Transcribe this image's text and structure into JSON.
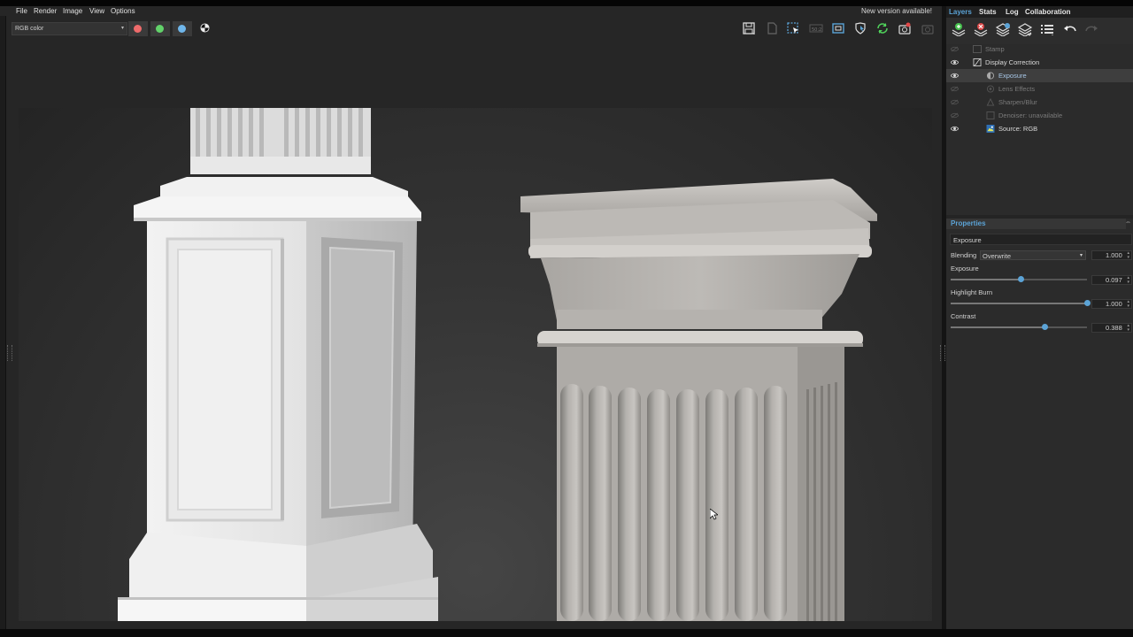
{
  "menu": {
    "items": [
      "File",
      "Render",
      "Image",
      "View",
      "Options"
    ],
    "update_notice": "New version available!"
  },
  "toolbar": {
    "display_mode": "RGB color",
    "channel_colors": {
      "red": "#ee6b6b",
      "green": "#62d26a",
      "blue": "#6fb6ea"
    },
    "icons": [
      "save-icon",
      "save-as-icon",
      "region-select-icon",
      "denoise-icon",
      "frame-icon",
      "shield-icon",
      "refresh-icon",
      "camera-reset-icon",
      "camera-icon"
    ]
  },
  "panel": {
    "tabs": [
      "Layers",
      "Stats",
      "Log",
      "Collaboration"
    ],
    "active_tab": "Layers",
    "layer_tools": [
      "add-layer-icon",
      "remove-layer-icon",
      "duplicate-layer-icon",
      "merge-layer-icon",
      "list-icon",
      "undo-icon",
      "redo-icon"
    ],
    "layers": [
      {
        "label": "Stamp",
        "visible": false,
        "state": "disabled"
      },
      {
        "label": "Display Correction",
        "visible": true,
        "state": "normal"
      },
      {
        "label": "Exposure",
        "visible": true,
        "state": "selected"
      },
      {
        "label": "Lens Effects",
        "visible": false,
        "state": "disabled"
      },
      {
        "label": "Sharpen/Blur",
        "visible": false,
        "state": "disabled"
      },
      {
        "label": "Denoiser: unavailable",
        "visible": false,
        "state": "disabled"
      },
      {
        "label": "Source: RGB",
        "visible": true,
        "state": "normal"
      }
    ]
  },
  "properties": {
    "header": "Properties",
    "layer_name": "Exposure",
    "blending_label": "Blending",
    "blending_mode": "Overwrite",
    "blending_value": "1.000",
    "exposure_label": "Exposure",
    "exposure_value": "0.097",
    "exposure_level": 0.51,
    "highlight_burn_label": "Highlight Burn",
    "highlight_burn_value": "1.000",
    "highlight_burn_level": 1.0,
    "contrast_label": "Contrast",
    "contrast_value": "0.388",
    "contrast_level": 0.69
  },
  "accent_color": "#5ba3d6"
}
